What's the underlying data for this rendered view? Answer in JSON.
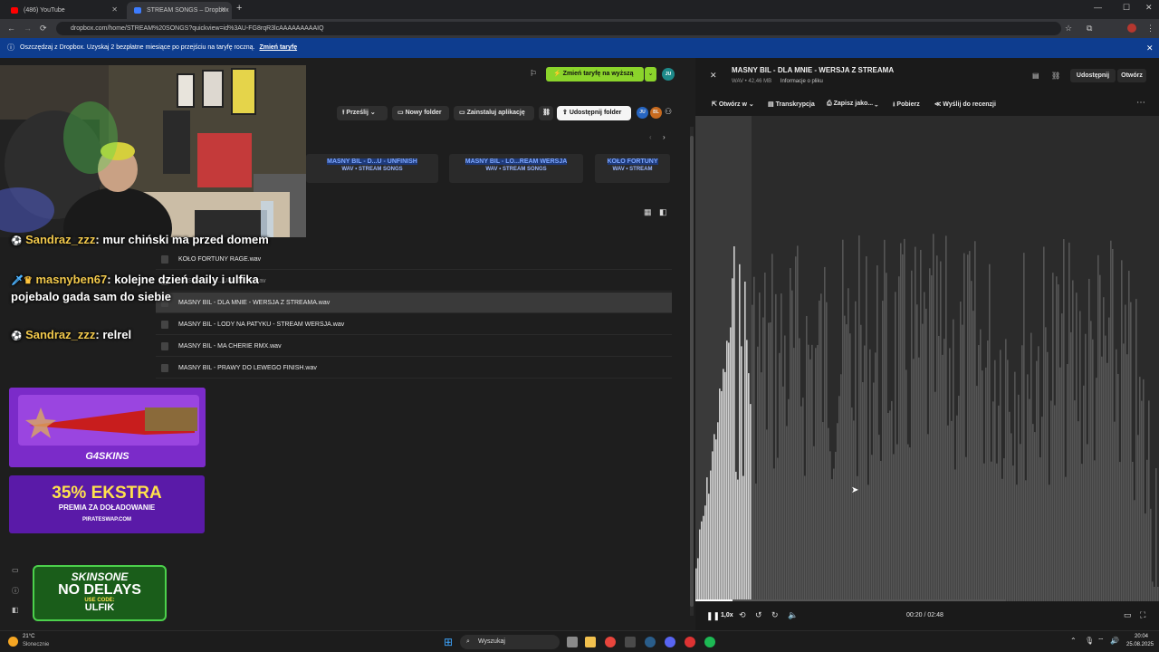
{
  "browser": {
    "tabs": [
      {
        "title": "(486) YouTube",
        "active": false
      },
      {
        "title": "STREAM SONGS – Dropbox",
        "active": true
      }
    ],
    "new_tab_label": "+",
    "url": "dropbox.com/home/STREAM%20SONGS?quickview=id%3AU-FG8rqR3lcAAAAAAAAAIQ"
  },
  "promo": {
    "text": "Oszczędzaj z Dropbox. Uzyskaj 2 bezpłatne miesiące po przejściu na taryfę roczną.",
    "link": "Zmień taryfę"
  },
  "dropbox": {
    "upgrade_button": "Zmień taryfę na wyższą",
    "avatar_initials": "JU",
    "toolbar": {
      "share": "Prześlij",
      "new_folder": "Nowy folder",
      "install_app": "Zainstaluj aplikację",
      "share_folder": "Udostępnij folder",
      "member1": "JU",
      "member2": "BL"
    },
    "suggested": [
      {
        "title": "MASNY BIL - D...U - UNFINISH",
        "sub": "WAV • STREAM SONGS"
      },
      {
        "title": "MASNY BIL - LO...REAM WERSJA",
        "sub": "WAV • STREAM SONGS"
      },
      {
        "title": "KOŁO FORTUNY",
        "sub": "WAV • STREAM"
      }
    ],
    "files": [
      {
        "name": "KOŁO FORTUNY RAGE.wav",
        "selected": false
      },
      {
        "name": "MASNY BIL - ...UNFINISH.wav",
        "selected": false
      },
      {
        "name": "MASNY BIL - DLA MNIE - WERSJA Z STREAMA.wav",
        "selected": true
      },
      {
        "name": "MASNY BIL - LODY NA PATYKU - STREAM WERSJA.wav",
        "selected": false
      },
      {
        "name": "MASNY BIL - MA CHERIE RMX.wav",
        "selected": false
      },
      {
        "name": "MASNY BIL - PRAWY DO LEWEGO FINISH.wav",
        "selected": false
      }
    ]
  },
  "chat": [
    {
      "user": "Sandraz_zzz",
      "message": "mur chiński ma przed domem"
    },
    {
      "user": "masnyben67",
      "message": "kolejne dzień daily i ulfika pojebalo gada sam do siebie"
    },
    {
      "user": "Sandraz_zzz",
      "message": "relrel"
    }
  ],
  "ads": {
    "g4skins": "G4SKINS",
    "pirate_big": "35% EKSTRA",
    "pirate_sub": "PREMIA ZA DOŁADOWANIE",
    "pirate_site": "PIRATESWAP.COM",
    "skinsone": "SKINSONE",
    "nodelays": "NO DELAYS",
    "usecode": "USE CODE:",
    "code": "ULFIK"
  },
  "preview": {
    "title": "MASNY BIL - DLA MNIE - WERSJA Z STREAMA",
    "meta": "WAV • 42,46 MB",
    "file_info": "Informacje o pliku",
    "share": "Udostępnij",
    "open": "Otwórz",
    "actions": {
      "open_in": "Otwórz w",
      "transcription": "Transkrypcja",
      "save_as": "Zapisz jako...",
      "download": "Pobierz",
      "send_review": "Wyślij do recenzji"
    },
    "playback": {
      "speed": "1,0x",
      "current": "00:20",
      "separator": "/",
      "total": "02:48",
      "progress": 0.12
    }
  },
  "taskbar": {
    "weather_temp": "21°C",
    "weather_desc": "Słonecznie",
    "search_placeholder": "Wyszukaj",
    "time": "20:04",
    "date": "25.08.2025"
  }
}
